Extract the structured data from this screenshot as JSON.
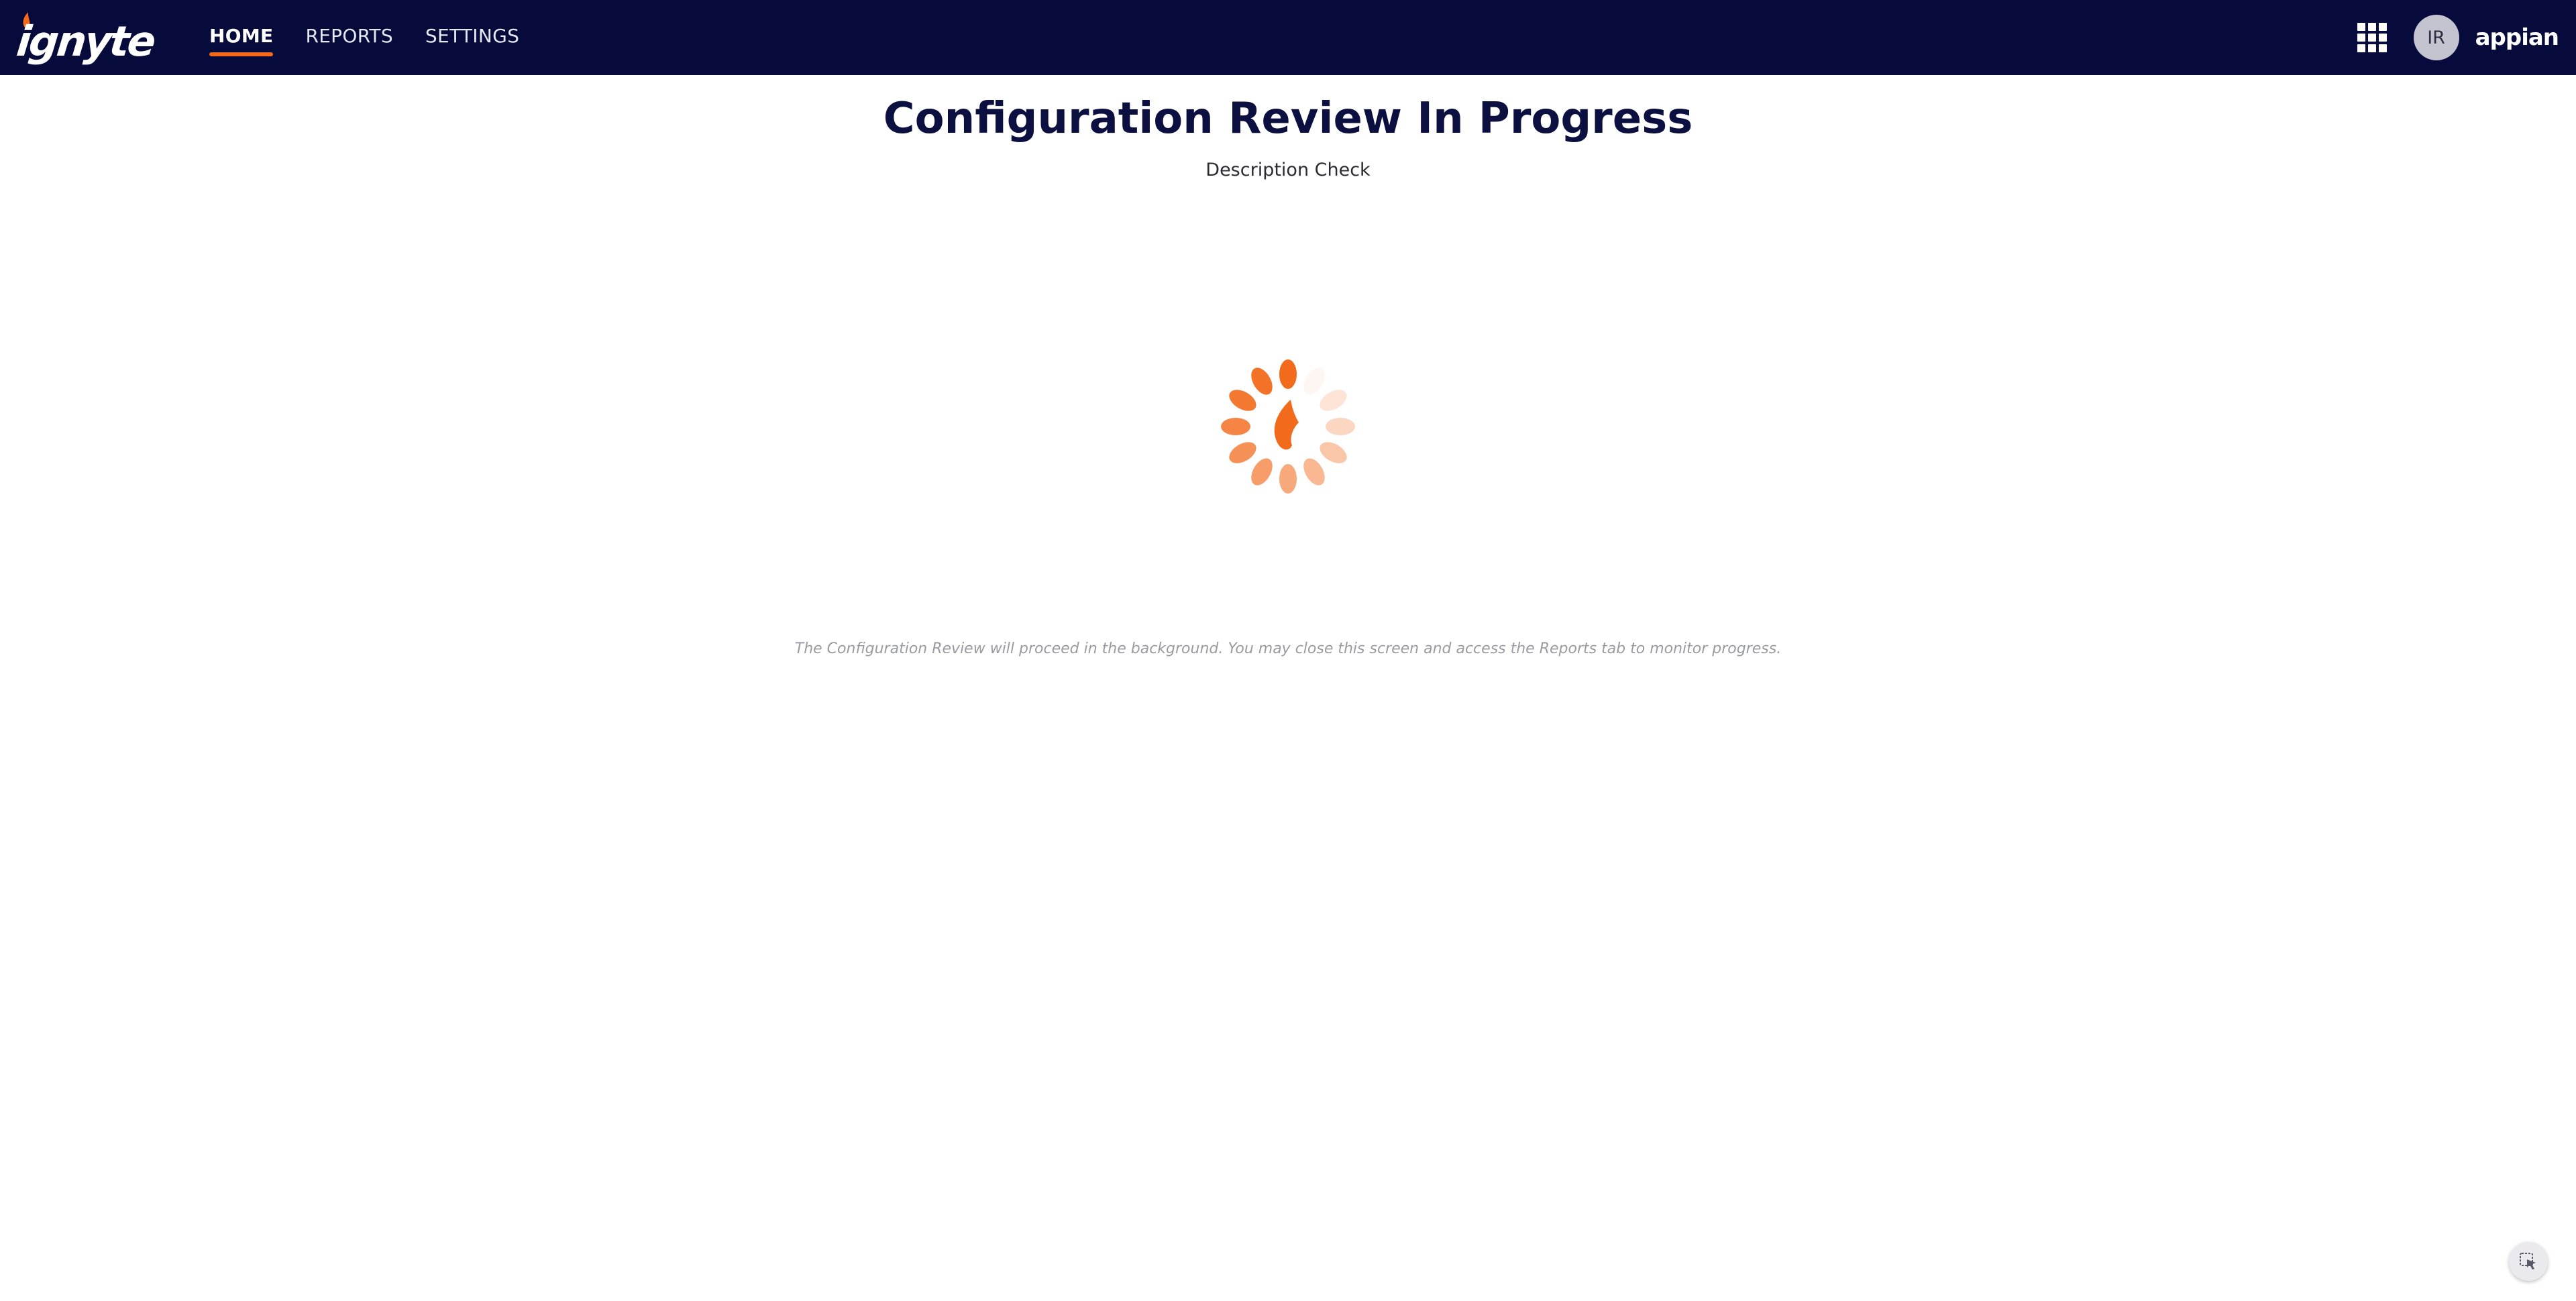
{
  "header": {
    "logo_text": "ignyte",
    "tabs": [
      {
        "label": "HOME",
        "active": true
      },
      {
        "label": "REPORTS",
        "active": false
      },
      {
        "label": "SETTINGS",
        "active": false
      }
    ],
    "apps_icon": "grid-icon",
    "avatar_initials": "IR",
    "brand_text": "appian",
    "colors": {
      "bar_background": "#060b3c",
      "active_tab_underline": "#f26a1b"
    }
  },
  "main": {
    "title": "Configuration Review In Progress",
    "subtitle": "Description Check",
    "loading_icon": "flame-spinner-icon",
    "footnote": "The Configuration Review will proceed in the background. You may close this screen and access the Reports tab to monitor progress.",
    "accent_color": "#f26a1b"
  },
  "corner_action": {
    "icon": "cursor-select-icon"
  }
}
